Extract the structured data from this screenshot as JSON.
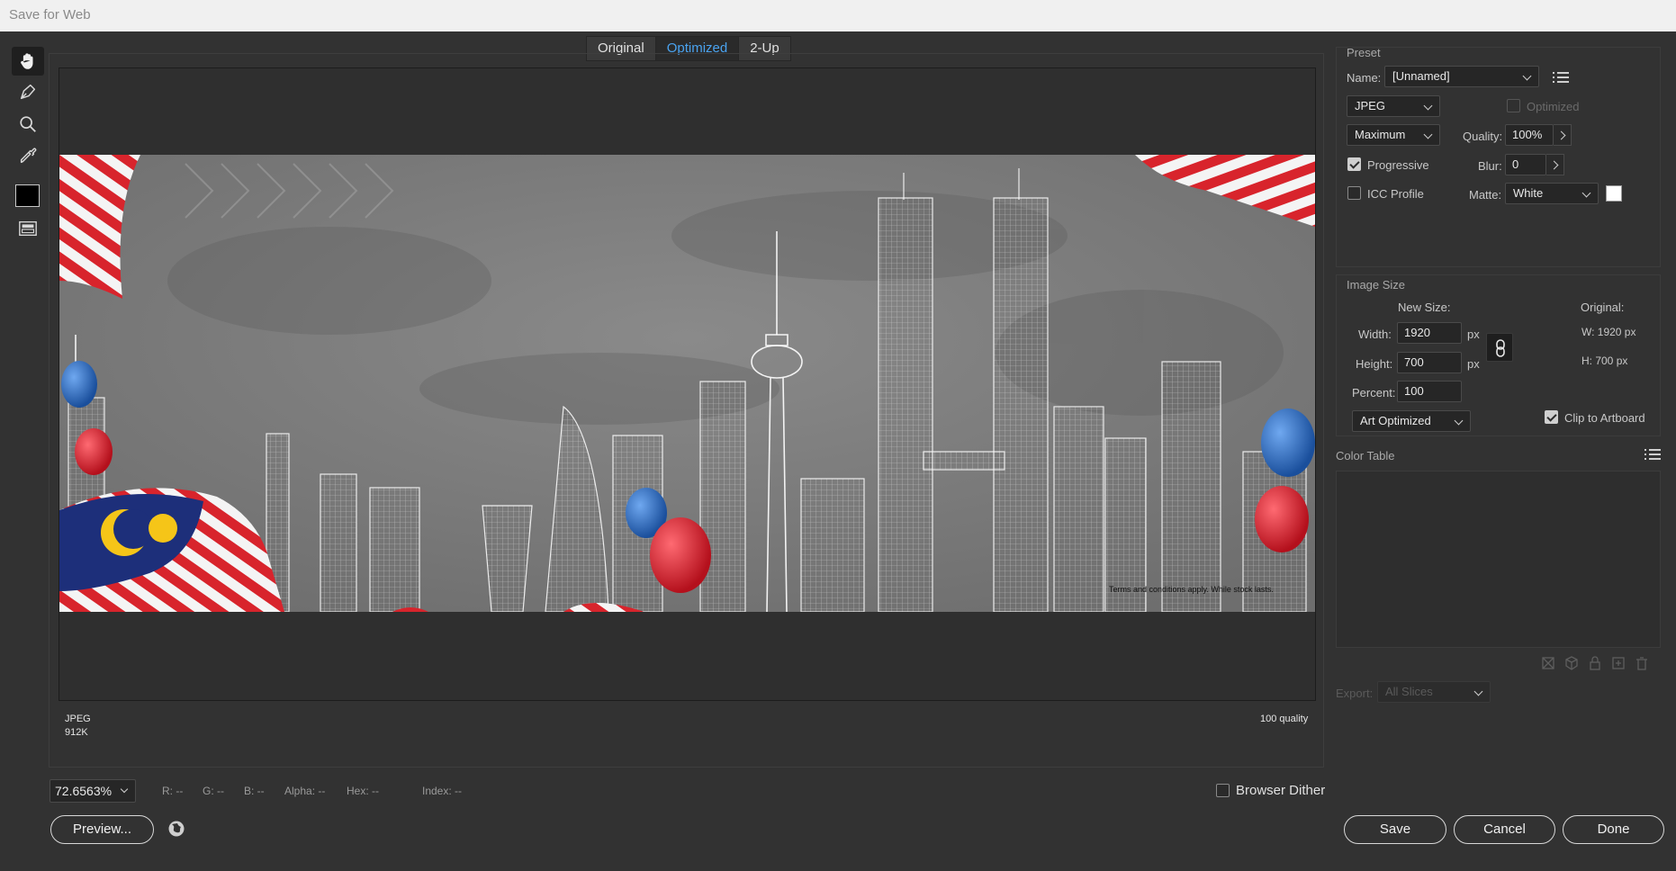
{
  "window": {
    "title": "Save for Web"
  },
  "tools": [
    {
      "name": "hand-tool",
      "icon": "hand-icon"
    },
    {
      "name": "slice-select-tool",
      "icon": "slice-select-icon"
    },
    {
      "name": "zoom-tool",
      "icon": "magnifier-icon"
    },
    {
      "name": "eyedropper-tool",
      "icon": "eyedropper-icon"
    },
    {
      "name": "eyedropper-color",
      "icon": "color-swatch-icon"
    },
    {
      "name": "toggle-slices-visibility",
      "icon": "slices-visibility-icon"
    }
  ],
  "view_tabs": [
    {
      "label": "Original",
      "active": false
    },
    {
      "label": "Optimized",
      "active": true
    },
    {
      "label": "2-Up",
      "active": false
    }
  ],
  "artwork": {
    "fine_print": "Terms and conditions apply. While stock lasts."
  },
  "preview_info": {
    "format": "JPEG",
    "size": "912K",
    "quality": "100 quality"
  },
  "preset": {
    "section_label": "Preset",
    "name_label": "Name:",
    "name_value": "[Unnamed]",
    "format": "JPEG",
    "optimized_label": "Optimized",
    "optimized_checked": false,
    "quality_level": "Maximum",
    "quality_label": "Quality:",
    "quality_value": "100%",
    "progressive_label": "Progressive",
    "progressive_checked": true,
    "blur_label": "Blur:",
    "blur_value": "0",
    "icc_label": "ICC Profile",
    "icc_checked": false,
    "matte_label": "Matte:",
    "matte_value": "White",
    "matte_color": "#ffffff"
  },
  "image_size": {
    "section_label": "Image Size",
    "new_size_label": "New Size:",
    "original_label": "Original:",
    "width_label": "Width:",
    "width_value": "1920",
    "height_label": "Height:",
    "height_value": "700",
    "unit": "px",
    "percent_label": "Percent:",
    "percent_value": "100",
    "orig_w": "W:  1920 px",
    "orig_h": "H:   700 px",
    "resample": "Art Optimized",
    "clip_label": "Clip to Artboard",
    "clip_checked": true
  },
  "color_table": {
    "section_label": "Color Table"
  },
  "export": {
    "label": "Export:",
    "value": "All Slices"
  },
  "status_bar": {
    "zoom": "72.6563%",
    "r": "R: --",
    "g": "G: --",
    "b": "B: --",
    "alpha": "Alpha: --",
    "hex": "Hex: --",
    "index": "Index: --",
    "browser_dither_label": "Browser Dither",
    "browser_dither_checked": false
  },
  "buttons": {
    "preview": "Preview...",
    "save": "Save",
    "cancel": "Cancel",
    "done": "Done"
  }
}
